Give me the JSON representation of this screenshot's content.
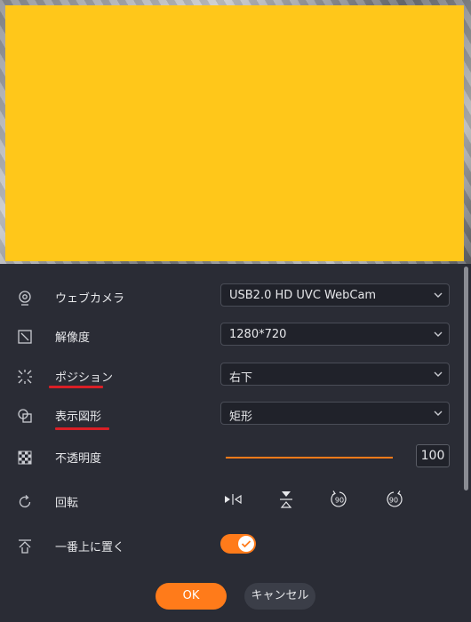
{
  "settings": {
    "webcam": {
      "label": "ウェブカメラ",
      "value": "USB2.0 HD UVC WebCam",
      "icon": "webcam-icon"
    },
    "resolution": {
      "label": "解像度",
      "value": "1280*720",
      "icon": "resolution-icon"
    },
    "position": {
      "label": "ポジション",
      "value": "右下",
      "icon": "position-icon"
    },
    "shape": {
      "label": "表示図形",
      "value": "矩形",
      "icon": "shape-icon"
    },
    "opacity": {
      "label": "不透明度",
      "value": "100",
      "level": 1.0,
      "icon": "opacity-icon"
    },
    "rotation": {
      "label": "回転",
      "icon": "rotate-icon",
      "buttons": [
        {
          "name": "flip-horizontal-icon"
        },
        {
          "name": "flip-vertical-icon"
        },
        {
          "name": "rotate-left-90-icon",
          "text": "90"
        },
        {
          "name": "rotate-right-90-icon",
          "text": "90"
        }
      ]
    },
    "always_on_top": {
      "label": "一番上に置く",
      "enabled": true,
      "icon": "bring-to-top-icon"
    }
  },
  "actions": {
    "ok_label": "OK",
    "cancel_label": "キャンセル"
  },
  "colors": {
    "accent": "#ff7b1a",
    "overlay": "#ffc71a",
    "panel_bg": "#2a2c35",
    "annotation_underline": "#d91f26"
  }
}
